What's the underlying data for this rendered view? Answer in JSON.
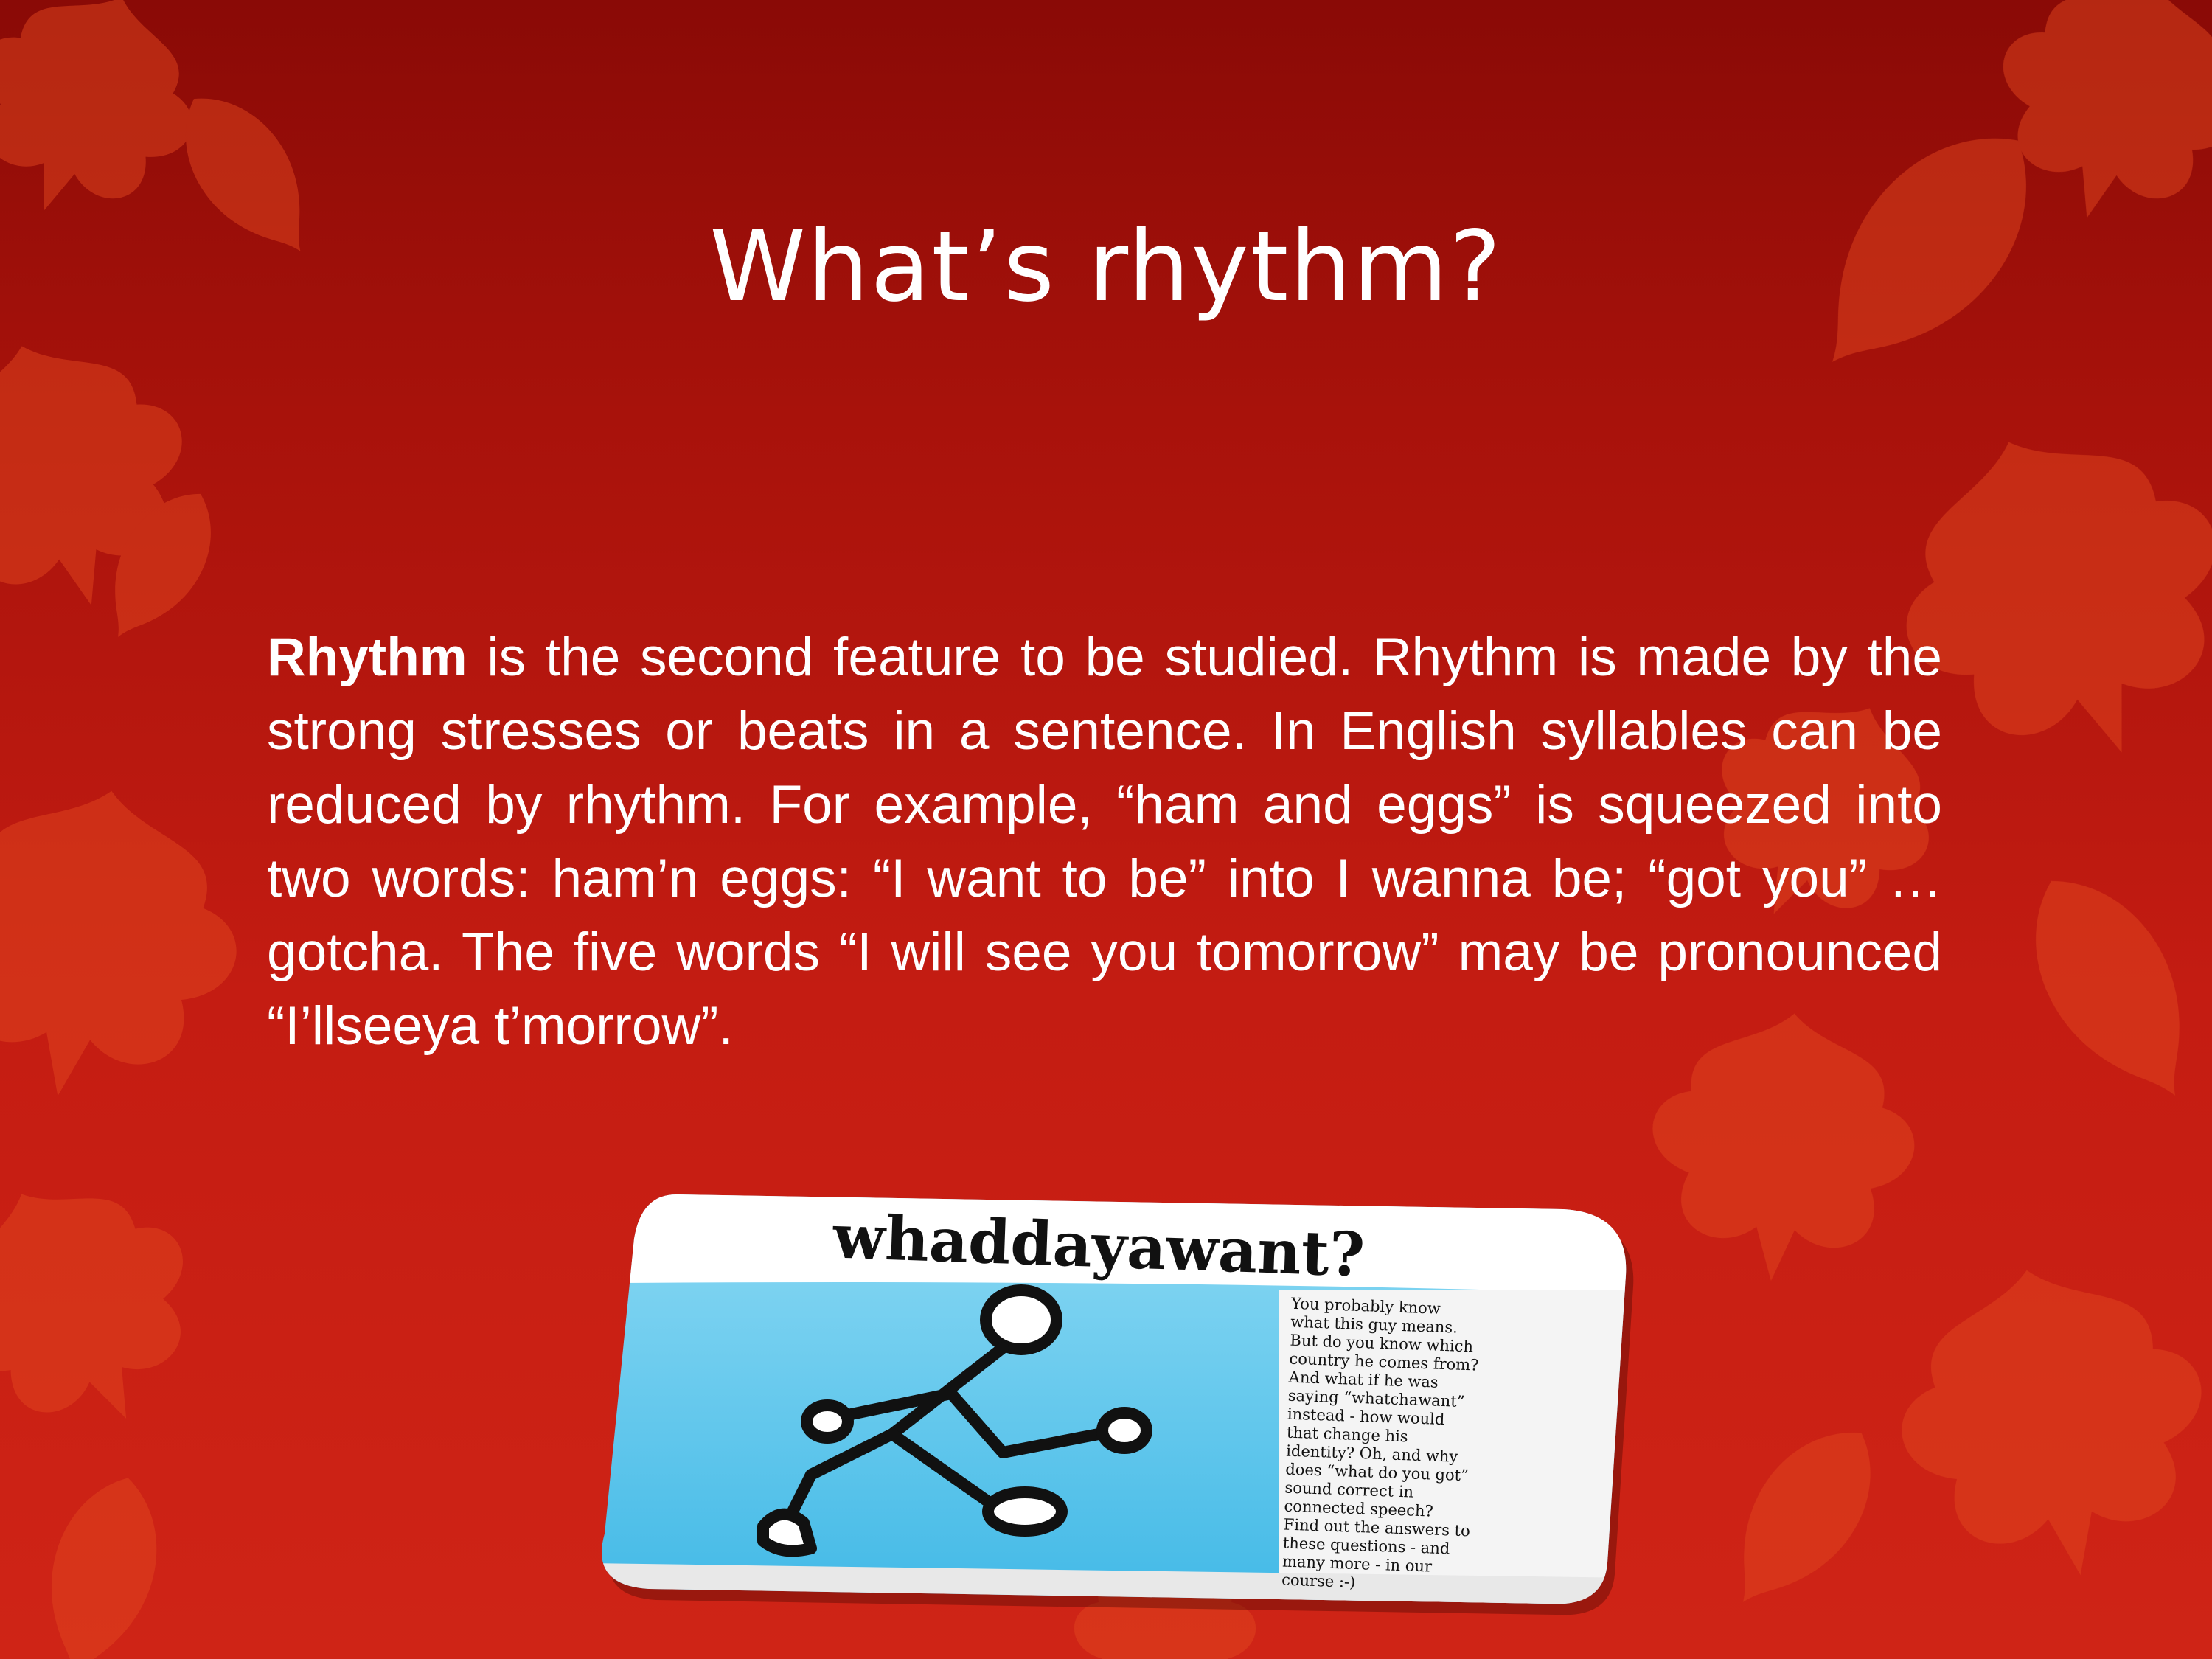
{
  "slide": {
    "title": "What’s rhythm?",
    "body_lead": "Rhythm",
    "body_rest": " is the second feature to be studied.  Rhythm is made by the strong stresses or beats in a sentence.  In English syllables can be reduced by rhythm.  For example, “ham and eggs” is squeezed into two words: ham’n eggs: “I want to be” into I wanna be; “got you” … gotcha.  The five words “I will see you tomorrow” may be pronounced “I’llseeya t’morrow”."
  },
  "card": {
    "heading": "whaddayawant?",
    "side_text_lines": [
      "You probably know",
      "what this guy means.",
      "But do you know which",
      "country he comes from?",
      "And what if he was",
      "saying “whatchawant”",
      "instead - how would",
      "that change his",
      "identity? Oh, and why",
      "does “what do you got”",
      "sound correct in",
      "connected speech?",
      "Find out the answers to",
      "these questions - and",
      "many more - in our",
      "course :-)"
    ],
    "figure_icon": "stick-figure-walking-icon"
  },
  "colors": {
    "background_top": "#8a0a06",
    "background_bottom": "#cf2416",
    "leaf": "#e0461f",
    "card_sky": "#5cc8ec",
    "text": "#ffffff"
  },
  "decor_icon": "autumn-leaves-icon"
}
